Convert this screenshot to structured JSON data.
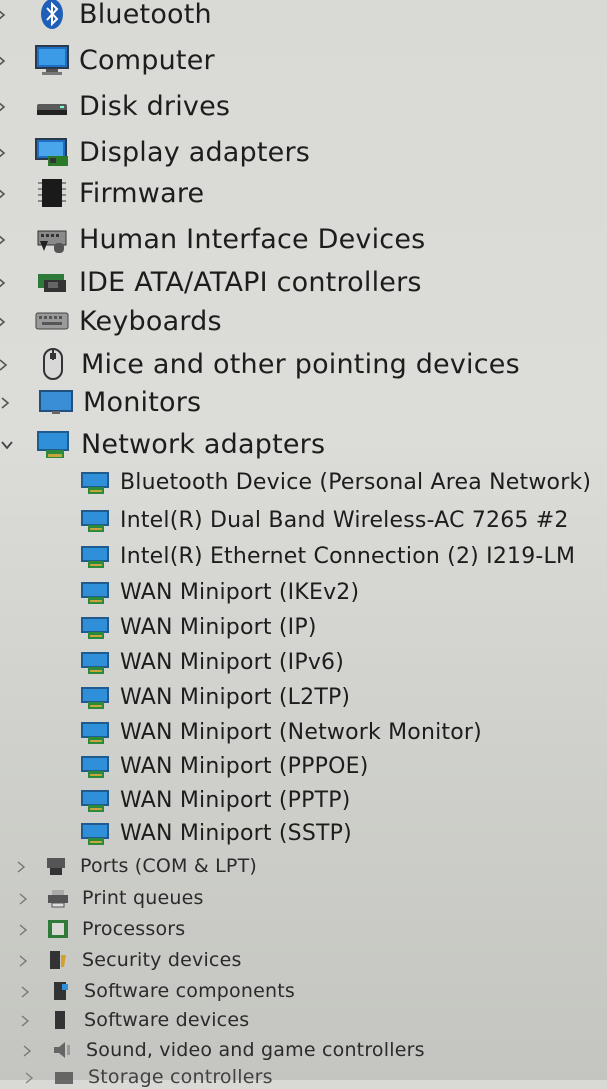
{
  "tree": {
    "items": [
      {
        "label": "Bluetooth",
        "icon": "bluetooth-icon",
        "expanded": false
      },
      {
        "label": "Computer",
        "icon": "computer-icon",
        "expanded": false
      },
      {
        "label": "Disk drives",
        "icon": "disk-drive-icon",
        "expanded": false
      },
      {
        "label": "Display adapters",
        "icon": "display-adapter-icon",
        "expanded": false
      },
      {
        "label": "Firmware",
        "icon": "firmware-icon",
        "expanded": false
      },
      {
        "label": "Human Interface Devices",
        "icon": "hid-icon",
        "expanded": false
      },
      {
        "label": "IDE ATA/ATAPI controllers",
        "icon": "ide-controller-icon",
        "expanded": false
      },
      {
        "label": "Keyboards",
        "icon": "keyboard-icon",
        "expanded": false
      },
      {
        "label": "Mice and other pointing devices",
        "icon": "mouse-icon",
        "expanded": false
      },
      {
        "label": "Monitors",
        "icon": "monitor-icon",
        "expanded": false
      },
      {
        "label": "Network adapters",
        "icon": "network-adapter-icon",
        "expanded": true
      },
      {
        "label": "Ports (COM & LPT)",
        "icon": "port-icon",
        "expanded": false
      },
      {
        "label": "Print queues",
        "icon": "printer-icon",
        "expanded": false
      },
      {
        "label": "Processors",
        "icon": "processor-icon",
        "expanded": false
      },
      {
        "label": "Security devices",
        "icon": "security-device-icon",
        "expanded": false
      },
      {
        "label": "Software components",
        "icon": "software-component-icon",
        "expanded": false
      },
      {
        "label": "Software devices",
        "icon": "software-device-icon",
        "expanded": false
      },
      {
        "label": "Sound, video and game controllers",
        "icon": "sound-icon",
        "expanded": false
      },
      {
        "label": "Storage controllers",
        "icon": "storage-controller-icon",
        "expanded": false
      }
    ],
    "network_children": [
      "Bluetooth Device (Personal Area Network)",
      "Intel(R) Dual Band Wireless-AC 7265 #2",
      "Intel(R) Ethernet Connection (2) I219-LM",
      "WAN Miniport (IKEv2)",
      "WAN Miniport (IP)",
      "WAN Miniport (IPv6)",
      "WAN Miniport (L2TP)",
      "WAN Miniport (Network Monitor)",
      "WAN Miniport (PPPOE)",
      "WAN Miniport (PPTP)",
      "WAN Miniport (SSTP)"
    ]
  },
  "colors": {
    "text": "#1d1d1d",
    "chevron": "#555555",
    "network_icon": "#2f8fd8",
    "monitor_icon": "#3a8ed6"
  }
}
